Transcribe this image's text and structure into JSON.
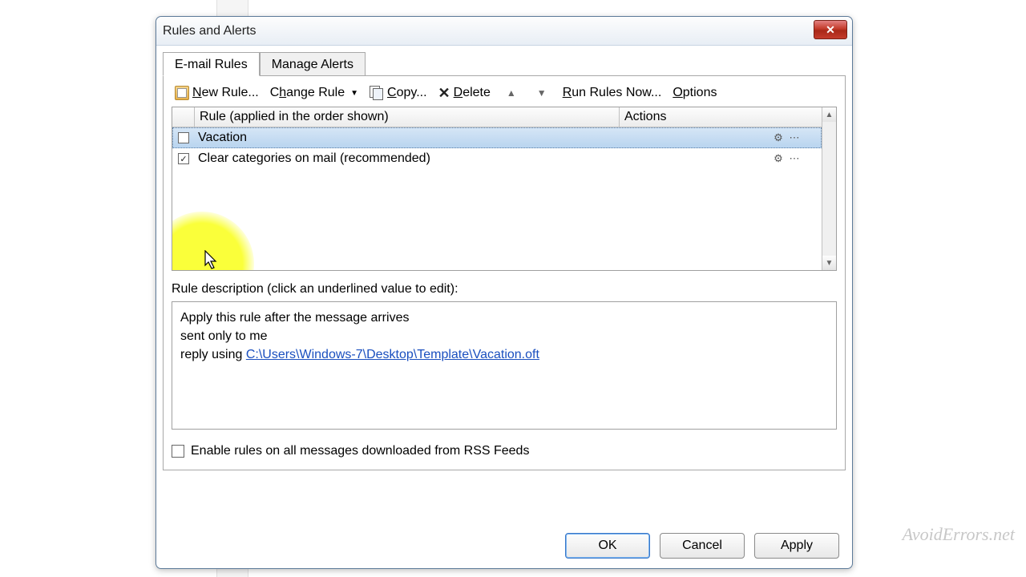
{
  "dialog": {
    "title": "Rules and Alerts"
  },
  "tabs": {
    "email_rules": "E-mail Rules",
    "manage_alerts": "Manage Alerts"
  },
  "toolbar": {
    "new_rule": "New Rule...",
    "change_rule": "Change Rule",
    "copy": "Copy...",
    "delete": "Delete",
    "run_rules": "Run Rules Now...",
    "options": "Options"
  },
  "list": {
    "header_rule": "Rule (applied in the order shown)",
    "header_actions": "Actions",
    "rows": [
      {
        "name": "Vacation",
        "checked": false,
        "selected": true
      },
      {
        "name": "Clear categories on mail (recommended)",
        "checked": true,
        "selected": false
      }
    ]
  },
  "description": {
    "label": "Rule description (click an underlined value to edit):",
    "line1": "Apply this rule after the message arrives",
    "line2": "sent only to me",
    "line3_prefix": "reply using ",
    "line3_link": "C:\\Users\\Windows-7\\Desktop\\Template\\Vacation.oft"
  },
  "rss": {
    "label": "Enable rules on all messages downloaded from RSS Feeds"
  },
  "buttons": {
    "ok": "OK",
    "cancel": "Cancel",
    "apply": "Apply"
  },
  "watermark": "AvoidErrors.net"
}
